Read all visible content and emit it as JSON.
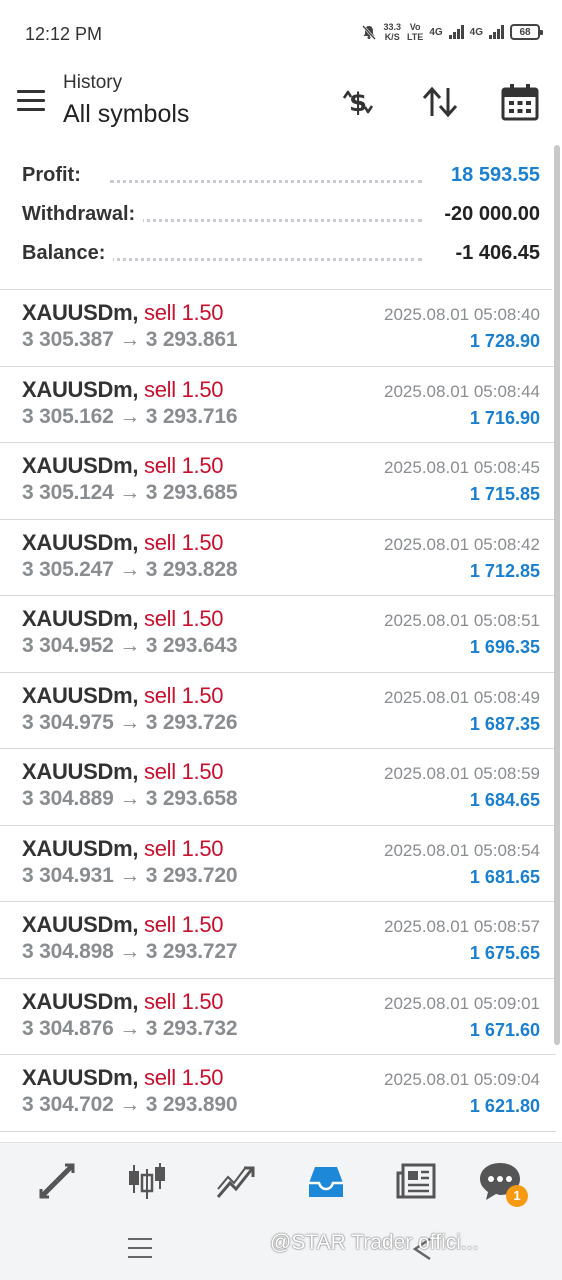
{
  "status_bar": {
    "time": "12:12 PM",
    "net_speed_value": "33.3",
    "net_speed_unit": "K/S",
    "volte_top": "Vo",
    "volte_bottom": "LTE",
    "sim1_network": "4G",
    "sim2_network": "4G",
    "battery": "68",
    "icons": [
      "mute-bell-icon",
      "signal-icon",
      "battery-icon"
    ]
  },
  "header": {
    "subtitle": "History",
    "title": "All symbols",
    "icons": [
      "menu-icon",
      "deposit-dollar-icon",
      "sort-icon",
      "calendar-icon"
    ]
  },
  "summary": {
    "profit_label": "Profit:",
    "profit_value": "18 593.55",
    "withdrawal_label": "Withdrawal:",
    "withdrawal_value": "-20 000.00",
    "balance_label": "Balance:",
    "balance_value": "-1 406.45",
    "profit_color": "#1a7fd0"
  },
  "deals": [
    {
      "symbol": "XAUUSDm,",
      "side": "sell 1.50",
      "open": "3 305.387",
      "close": "3 293.861",
      "time": "2025.08.01 05:08:40",
      "profit": "1 728.90"
    },
    {
      "symbol": "XAUUSDm,",
      "side": "sell 1.50",
      "open": "3 305.162",
      "close": "3 293.716",
      "time": "2025.08.01 05:08:44",
      "profit": "1 716.90"
    },
    {
      "symbol": "XAUUSDm,",
      "side": "sell 1.50",
      "open": "3 305.124",
      "close": "3 293.685",
      "time": "2025.08.01 05:08:45",
      "profit": "1 715.85"
    },
    {
      "symbol": "XAUUSDm,",
      "side": "sell 1.50",
      "open": "3 305.247",
      "close": "3 293.828",
      "time": "2025.08.01 05:08:42",
      "profit": "1 712.85"
    },
    {
      "symbol": "XAUUSDm,",
      "side": "sell 1.50",
      "open": "3 304.952",
      "close": "3 293.643",
      "time": "2025.08.01 05:08:51",
      "profit": "1 696.35"
    },
    {
      "symbol": "XAUUSDm,",
      "side": "sell 1.50",
      "open": "3 304.975",
      "close": "3 293.726",
      "time": "2025.08.01 05:08:49",
      "profit": "1 687.35"
    },
    {
      "symbol": "XAUUSDm,",
      "side": "sell 1.50",
      "open": "3 304.889",
      "close": "3 293.658",
      "time": "2025.08.01 05:08:59",
      "profit": "1 684.65"
    },
    {
      "symbol": "XAUUSDm,",
      "side": "sell 1.50",
      "open": "3 304.931",
      "close": "3 293.720",
      "time": "2025.08.01 05:08:54",
      "profit": "1 681.65"
    },
    {
      "symbol": "XAUUSDm,",
      "side": "sell 1.50",
      "open": "3 304.898",
      "close": "3 293.727",
      "time": "2025.08.01 05:08:57",
      "profit": "1 675.65"
    },
    {
      "symbol": "XAUUSDm,",
      "side": "sell 1.50",
      "open": "3 304.876",
      "close": "3 293.732",
      "time": "2025.08.01 05:09:01",
      "profit": "1 671.60"
    },
    {
      "symbol": "XAUUSDm,",
      "side": "sell 1.50",
      "open": "3 304.702",
      "close": "3 293.890",
      "time": "2025.08.01 05:09:04",
      "profit": "1 621.80"
    }
  ],
  "arrow_glyph": "→",
  "colors": {
    "sell": "#c8102e",
    "profit": "#1a7fd0",
    "active_nav": "#1e88d8"
  },
  "bottom_nav": {
    "items": [
      "quotes-icon",
      "chart-icon",
      "trade-icon",
      "history-icon",
      "news-icon",
      "messages-icon"
    ],
    "active": "history-icon",
    "messages_badge": "1"
  },
  "watermark": "@STAR Trader offici..."
}
